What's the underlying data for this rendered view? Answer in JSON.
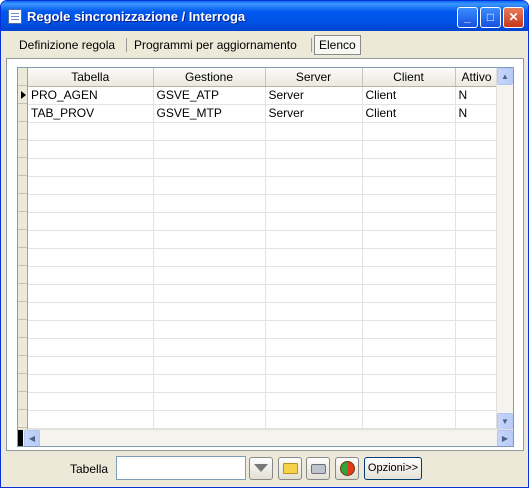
{
  "window": {
    "title": "Regole sincronizzazione / Interroga"
  },
  "tabs": [
    {
      "label": "Definizione regola"
    },
    {
      "label": "Programmi per aggiornamento"
    },
    {
      "label": "Elenco"
    }
  ],
  "grid": {
    "columns": [
      "Tabella",
      "Gestione",
      "Server",
      "Client",
      "Attivo"
    ],
    "rows": [
      [
        "PRO_AGEN",
        "GSVE_ATP",
        "Server",
        "Client",
        "N"
      ],
      [
        "TAB_PROV",
        "GSVE_MTP",
        "Server",
        "Client",
        "N"
      ]
    ],
    "selected_row": 0
  },
  "footer": {
    "label": "Tabella",
    "input_value": "",
    "options_label": "Opzioni>>",
    "icons": [
      "filter-icon",
      "folder-icon",
      "print-icon",
      "refresh-icon"
    ]
  }
}
